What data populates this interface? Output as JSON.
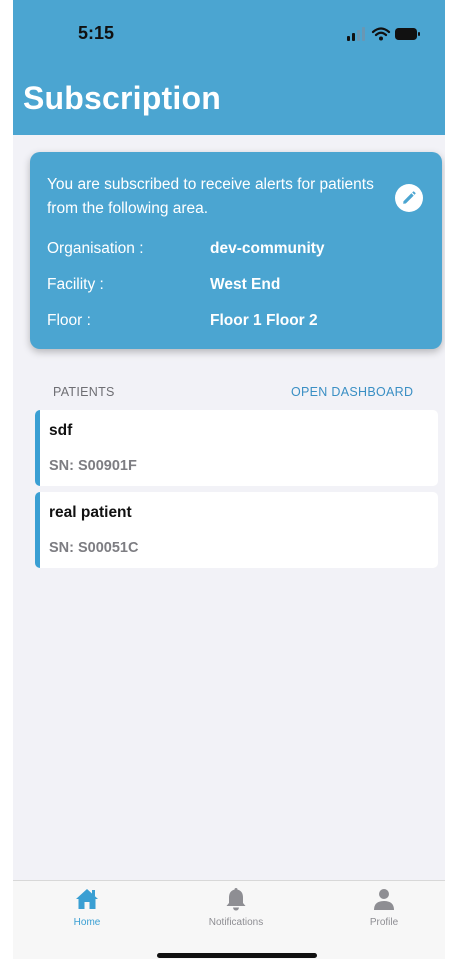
{
  "status_bar": {
    "time": "5:15"
  },
  "header": {
    "title": "Subscription"
  },
  "subscription_card": {
    "intro": "You are subscribed to receive alerts for patients from the following area.",
    "edit_icon": "pencil-icon",
    "rows": [
      {
        "label": "Organisation  :",
        "value": "dev-community"
      },
      {
        "label": "Facility  :",
        "value": "West End"
      },
      {
        "label": "Floor  :",
        "value": "Floor 1  Floor 2"
      }
    ]
  },
  "patients": {
    "section_label": "PATIENTS",
    "dashboard_link": "OPEN DASHBOARD",
    "items": [
      {
        "name": "sdf",
        "sn": "SN: S00901F"
      },
      {
        "name": "real patient",
        "sn": "SN: S00051C"
      }
    ]
  },
  "tab_bar": {
    "tabs": [
      {
        "label": "Home",
        "icon": "home-icon",
        "active": true
      },
      {
        "label": "Notifications",
        "icon": "bell-icon",
        "active": false
      },
      {
        "label": "Profile",
        "icon": "person-icon",
        "active": false
      }
    ]
  },
  "colors": {
    "primary": "#4ba5d1",
    "accent": "#3a9fd3",
    "background": "#f2f2f7",
    "inactive": "#8e8e93"
  }
}
